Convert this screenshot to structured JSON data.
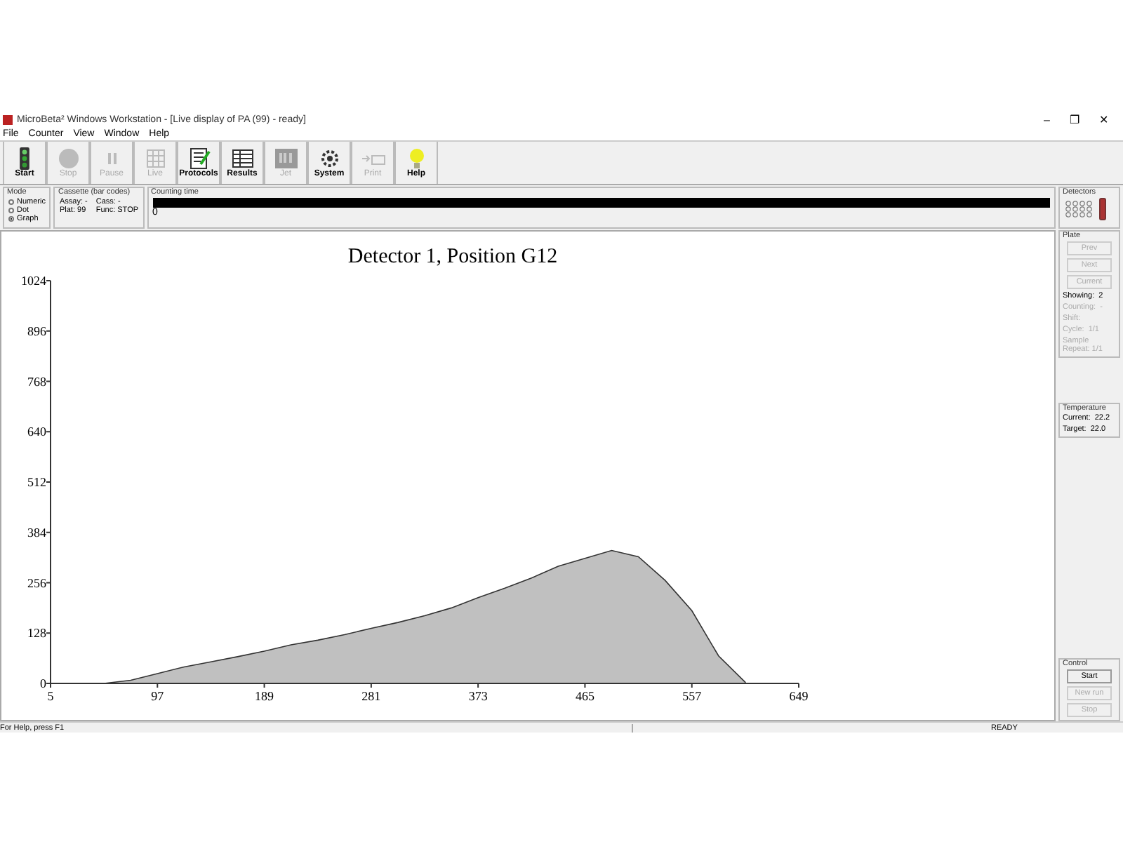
{
  "window": {
    "title": "MicroBeta² Windows Workstation - [Live display of PA (99) - ready]",
    "controls": [
      "–",
      "❐",
      "✕"
    ]
  },
  "menu": [
    "File",
    "Counter",
    "View",
    "Window",
    "Help"
  ],
  "toolbar": [
    {
      "label": "Start",
      "kind": "start",
      "disabled": false
    },
    {
      "label": "Stop",
      "kind": "stop",
      "disabled": true
    },
    {
      "label": "Pause",
      "kind": "pause",
      "disabled": true
    },
    {
      "label": "Live",
      "kind": "live",
      "disabled": true
    },
    {
      "label": "Protocols",
      "kind": "protocols",
      "disabled": false
    },
    {
      "label": "Results",
      "kind": "results",
      "disabled": false
    },
    {
      "label": "Jet",
      "kind": "jet",
      "disabled": true
    },
    {
      "label": "System",
      "kind": "system",
      "disabled": false
    },
    {
      "label": "Print",
      "kind": "print",
      "disabled": true
    },
    {
      "label": "Help",
      "kind": "help",
      "disabled": false
    }
  ],
  "mode": {
    "title": "Mode",
    "options": [
      {
        "label": "Numeric",
        "selected": false
      },
      {
        "label": "Dot",
        "selected": false
      },
      {
        "label": "Graph",
        "selected": true
      }
    ]
  },
  "cassette": {
    "title": "Cassette (bar codes)",
    "fields": [
      "Assay: -",
      "Cass: -",
      "Plat: 99",
      "Func: STOP"
    ]
  },
  "counting_time": {
    "title": "Counting time",
    "value": "0"
  },
  "chart": {
    "chart_data": {
      "type": "area",
      "title": "Detector 1, Position G12",
      "x": [
        51,
        74,
        97,
        120,
        143,
        166,
        189,
        212,
        235,
        258,
        281,
        304,
        327,
        350,
        373,
        396,
        419,
        442,
        465,
        488,
        511,
        534,
        557,
        580,
        603
      ],
      "series": [
        {
          "color": "#c0c0c0",
          "values": [
            0,
            8,
            25,
            42,
            55,
            68,
            82,
            98,
            110,
            124,
            140,
            155,
            172,
            192,
            218,
            242,
            268,
            298,
            318,
            338,
            322,
            262,
            185,
            70,
            3
          ]
        }
      ],
      "xlim": [
        5,
        649
      ],
      "ylim": [
        0,
        1024
      ],
      "xticks": [
        5,
        97,
        189,
        281,
        373,
        465,
        557,
        649
      ],
      "yticks": [
        0,
        128,
        256,
        384,
        512,
        640,
        768,
        896,
        1024
      ]
    }
  },
  "detectors": {
    "title": "Detectors"
  },
  "plate": {
    "title": "Plate",
    "buttons": [
      {
        "label": "Prev",
        "disabled": true
      },
      {
        "label": "Next",
        "disabled": true
      },
      {
        "label": "Current",
        "disabled": true
      }
    ],
    "rows": [
      {
        "text": "Showing:  2",
        "disabled": false
      },
      {
        "text": "Counting:  -",
        "disabled": true
      },
      {
        "text": "Shift:",
        "disabled": true
      },
      {
        "text": "Cycle:  1/1",
        "disabled": true
      },
      {
        "text": "Sample Repeat: 1/1",
        "disabled": true
      }
    ]
  },
  "temperature": {
    "title": "Temperature",
    "rows": [
      {
        "label": "Current:",
        "value": "22.2"
      },
      {
        "label": "Target:",
        "value": "22.0"
      }
    ]
  },
  "control": {
    "title": "Control",
    "buttons": [
      {
        "label": "Start",
        "disabled": false
      },
      {
        "label": "New run",
        "disabled": true
      },
      {
        "label": "Stop",
        "disabled": true
      }
    ]
  },
  "status_bar": {
    "help": "For Help, press F1",
    "state": "READY"
  }
}
